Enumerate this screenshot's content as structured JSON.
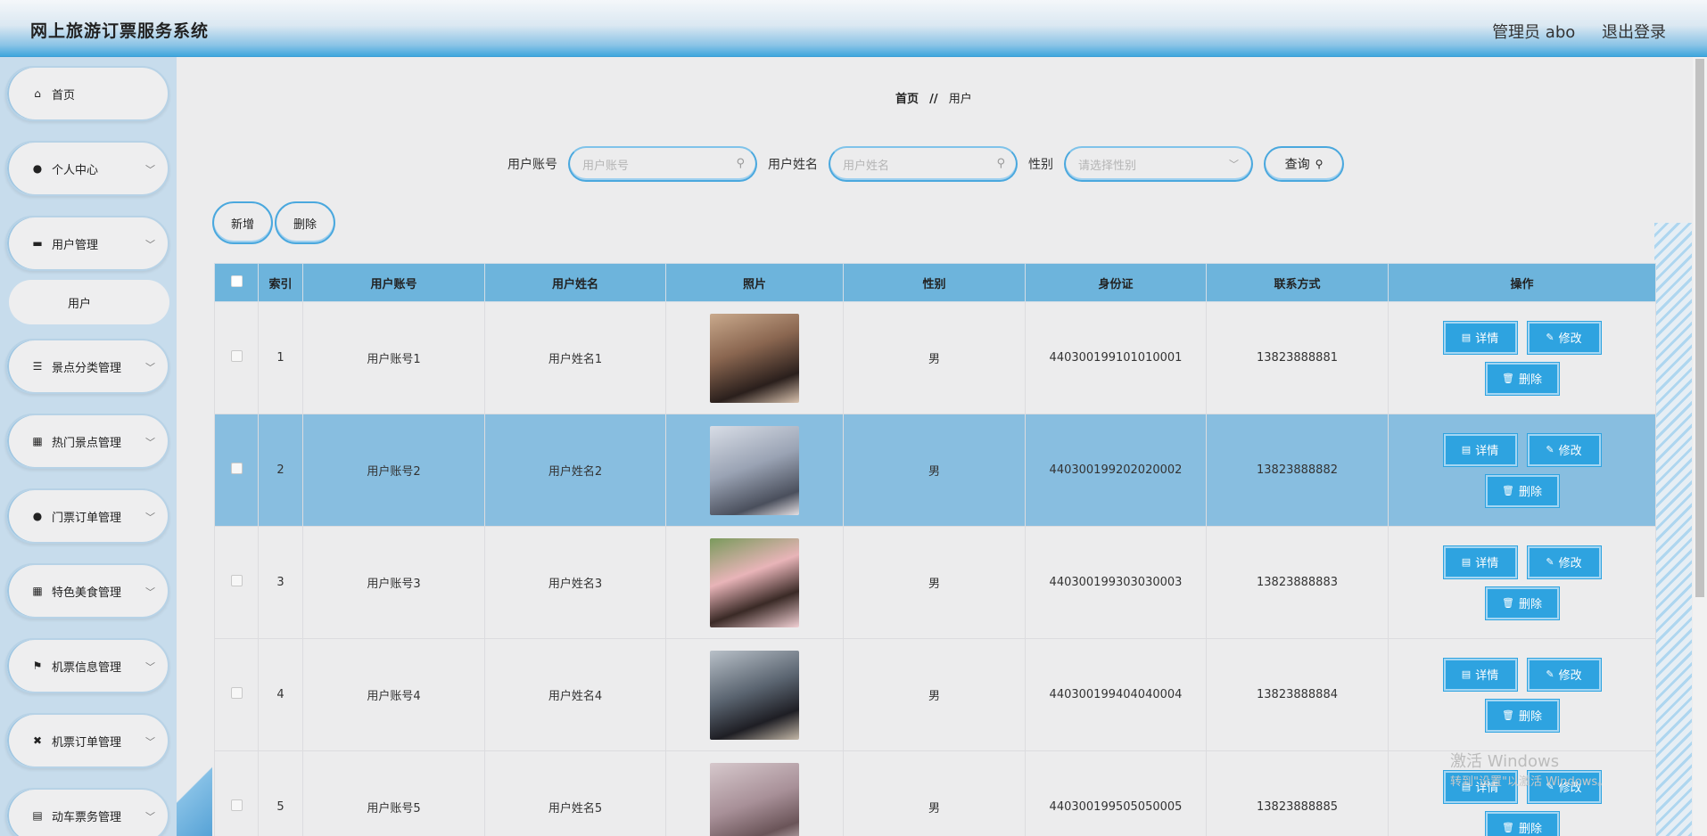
{
  "header": {
    "title": "网上旅游订票服务系统",
    "user_label": "管理员 abo",
    "logout": "退出登录"
  },
  "sidebar": {
    "items": [
      {
        "label": "首页",
        "icon": "home-icon",
        "has_children": false
      },
      {
        "label": "个人中心",
        "icon": "person-icon",
        "has_children": true
      },
      {
        "label": "用户管理",
        "icon": "monitor-icon",
        "has_children": true
      },
      {
        "label": "景点分类管理",
        "icon": "list-icon",
        "has_children": true
      },
      {
        "label": "热门景点管理",
        "icon": "grid-icon",
        "has_children": true
      },
      {
        "label": "门票订单管理",
        "icon": "person-icon",
        "has_children": true
      },
      {
        "label": "特色美食管理",
        "icon": "grid-icon",
        "has_children": true
      },
      {
        "label": "机票信息管理",
        "icon": "flag-icon",
        "has_children": true
      },
      {
        "label": "机票订单管理",
        "icon": "ticket-icon",
        "has_children": true
      },
      {
        "label": "动车票务管理",
        "icon": "clipboard-icon",
        "has_children": true
      }
    ],
    "sub_item": {
      "label": "用户"
    }
  },
  "breadcrumb": {
    "home": "首页",
    "sep": "//",
    "current": "用户"
  },
  "search": {
    "account_label": "用户账号",
    "account_placeholder": "用户账号",
    "name_label": "用户姓名",
    "name_placeholder": "用户姓名",
    "gender_label": "性别",
    "gender_placeholder": "请选择性别",
    "query": "查询"
  },
  "actions": {
    "add": "新增",
    "delete": "删除"
  },
  "table": {
    "headers": [
      "索引",
      "用户账号",
      "用户姓名",
      "照片",
      "性别",
      "身份证",
      "联系方式",
      "操作"
    ],
    "rows": [
      {
        "index": "1",
        "account": "用户账号1",
        "name": "用户姓名1",
        "gender": "男",
        "id_card": "440300199101010001",
        "phone": "13823888881"
      },
      {
        "index": "2",
        "account": "用户账号2",
        "name": "用户姓名2",
        "gender": "男",
        "id_card": "440300199202020002",
        "phone": "13823888882"
      },
      {
        "index": "3",
        "account": "用户账号3",
        "name": "用户姓名3",
        "gender": "男",
        "id_card": "440300199303030003",
        "phone": "13823888883"
      },
      {
        "index": "4",
        "account": "用户账号4",
        "name": "用户姓名4",
        "gender": "男",
        "id_card": "440300199404040004",
        "phone": "13823888884"
      },
      {
        "index": "5",
        "account": "用户账号5",
        "name": "用户姓名5",
        "gender": "男",
        "id_card": "440300199505050005",
        "phone": "13823888885"
      }
    ],
    "ops": {
      "detail": "详情",
      "edit": "修改",
      "delete": "删除"
    }
  },
  "watermark": {
    "line1": "激活 Windows",
    "line2": "转到\"设置\"以激活 Windows。"
  },
  "colors": {
    "accent": "#2ea3e0",
    "header_row": "#6db4dc",
    "highlight_row": "#88bee0"
  }
}
